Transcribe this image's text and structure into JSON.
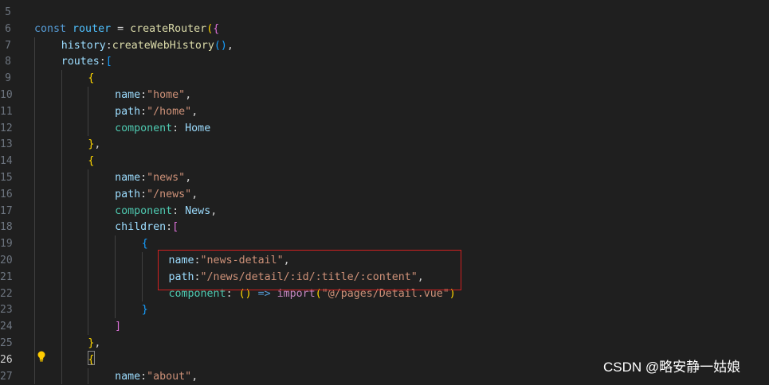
{
  "lines": [
    {
      "no": "5",
      "indent": 0,
      "tokens": []
    },
    {
      "no": "6",
      "indent": 0,
      "tokens": [
        {
          "t": "const ",
          "c": "kw"
        },
        {
          "t": "router",
          "c": "const"
        },
        {
          "t": " = ",
          "c": "op"
        },
        {
          "t": "createRouter",
          "c": "fn"
        },
        {
          "t": "(",
          "c": "b1"
        },
        {
          "t": "{",
          "c": "b2"
        }
      ]
    },
    {
      "no": "7",
      "indent": 1,
      "tokens": [
        {
          "t": "history",
          "c": "prop"
        },
        {
          "t": ":",
          "c": "op"
        },
        {
          "t": "createWebHistory",
          "c": "fn"
        },
        {
          "t": "()",
          "c": "b3"
        },
        {
          "t": ",",
          "c": "op"
        }
      ]
    },
    {
      "no": "8",
      "indent": 1,
      "tokens": [
        {
          "t": "routes",
          "c": "prop"
        },
        {
          "t": ":",
          "c": "op"
        },
        {
          "t": "[",
          "c": "b3"
        }
      ]
    },
    {
      "no": "9",
      "indent": 2,
      "tokens": [
        {
          "t": "{",
          "c": "b1"
        }
      ]
    },
    {
      "no": "10",
      "indent": 3,
      "tokens": [
        {
          "t": "name",
          "c": "prop"
        },
        {
          "t": ":",
          "c": "op"
        },
        {
          "t": "\"home\"",
          "c": "str"
        },
        {
          "t": ",",
          "c": "op"
        }
      ]
    },
    {
      "no": "11",
      "indent": 3,
      "tokens": [
        {
          "t": "path",
          "c": "prop"
        },
        {
          "t": ":",
          "c": "op"
        },
        {
          "t": "\"/home\"",
          "c": "str"
        },
        {
          "t": ",",
          "c": "op"
        }
      ]
    },
    {
      "no": "12",
      "indent": 3,
      "tokens": [
        {
          "t": "component",
          "c": "cls"
        },
        {
          "t": ": ",
          "c": "op"
        },
        {
          "t": "Home",
          "c": "var"
        }
      ]
    },
    {
      "no": "13",
      "indent": 2,
      "tokens": [
        {
          "t": "}",
          "c": "b1"
        },
        {
          "t": ",",
          "c": "op"
        }
      ]
    },
    {
      "no": "14",
      "indent": 2,
      "tokens": [
        {
          "t": "{",
          "c": "b1"
        }
      ]
    },
    {
      "no": "15",
      "indent": 3,
      "tokens": [
        {
          "t": "name",
          "c": "prop"
        },
        {
          "t": ":",
          "c": "op"
        },
        {
          "t": "\"news\"",
          "c": "str"
        },
        {
          "t": ",",
          "c": "op"
        }
      ]
    },
    {
      "no": "16",
      "indent": 3,
      "tokens": [
        {
          "t": "path",
          "c": "prop"
        },
        {
          "t": ":",
          "c": "op"
        },
        {
          "t": "\"/news\"",
          "c": "str"
        },
        {
          "t": ",",
          "c": "op"
        }
      ]
    },
    {
      "no": "17",
      "indent": 3,
      "tokens": [
        {
          "t": "component",
          "c": "cls"
        },
        {
          "t": ": ",
          "c": "op"
        },
        {
          "t": "News",
          "c": "var"
        },
        {
          "t": ",",
          "c": "op"
        }
      ]
    },
    {
      "no": "18",
      "indent": 3,
      "tokens": [
        {
          "t": "children",
          "c": "prop"
        },
        {
          "t": ":",
          "c": "op"
        },
        {
          "t": "[",
          "c": "b2"
        }
      ]
    },
    {
      "no": "19",
      "indent": 4,
      "tokens": [
        {
          "t": "{",
          "c": "b3"
        }
      ]
    },
    {
      "no": "20",
      "indent": 5,
      "tokens": [
        {
          "t": "name",
          "c": "prop"
        },
        {
          "t": ":",
          "c": "op"
        },
        {
          "t": "\"news-detail\"",
          "c": "str"
        },
        {
          "t": ",",
          "c": "op"
        }
      ]
    },
    {
      "no": "21",
      "indent": 5,
      "tokens": [
        {
          "t": "path",
          "c": "prop"
        },
        {
          "t": ":",
          "c": "op"
        },
        {
          "t": "\"/news/detail/:id/:title/:content\"",
          "c": "str"
        },
        {
          "t": ",",
          "c": "op"
        }
      ]
    },
    {
      "no": "22",
      "indent": 5,
      "tokens": [
        {
          "t": "component",
          "c": "cls"
        },
        {
          "t": ": ",
          "c": "op"
        },
        {
          "t": "()",
          "c": "b1"
        },
        {
          "t": " => ",
          "c": "kw"
        },
        {
          "t": "import",
          "c": "import"
        },
        {
          "t": "(",
          "c": "b1"
        },
        {
          "t": "\"@/pages/Detail.vue\"",
          "c": "str"
        },
        {
          "t": ")",
          "c": "b1"
        }
      ]
    },
    {
      "no": "23",
      "indent": 4,
      "tokens": [
        {
          "t": "}",
          "c": "b3"
        }
      ]
    },
    {
      "no": "24",
      "indent": 3,
      "tokens": [
        {
          "t": "]",
          "c": "b2"
        }
      ]
    },
    {
      "no": "25",
      "indent": 2,
      "tokens": [
        {
          "t": "}",
          "c": "b1"
        },
        {
          "t": ",",
          "c": "op"
        }
      ]
    },
    {
      "no": "26",
      "indent": 2,
      "active": true,
      "tokens": [
        {
          "t": "{",
          "c": "b1"
        }
      ]
    },
    {
      "no": "27",
      "indent": 3,
      "tokens": [
        {
          "t": "name",
          "c": "prop"
        },
        {
          "t": ":",
          "c": "op"
        },
        {
          "t": "\"about\"",
          "c": "str"
        },
        {
          "t": ",",
          "c": "op"
        }
      ]
    }
  ],
  "icons": {
    "lightbulb": "lightbulb-icon"
  },
  "colors": {
    "background": "#1f1f1f",
    "highlight_border": "#d02020"
  },
  "watermark": "CSDN @略安静一姑娘"
}
